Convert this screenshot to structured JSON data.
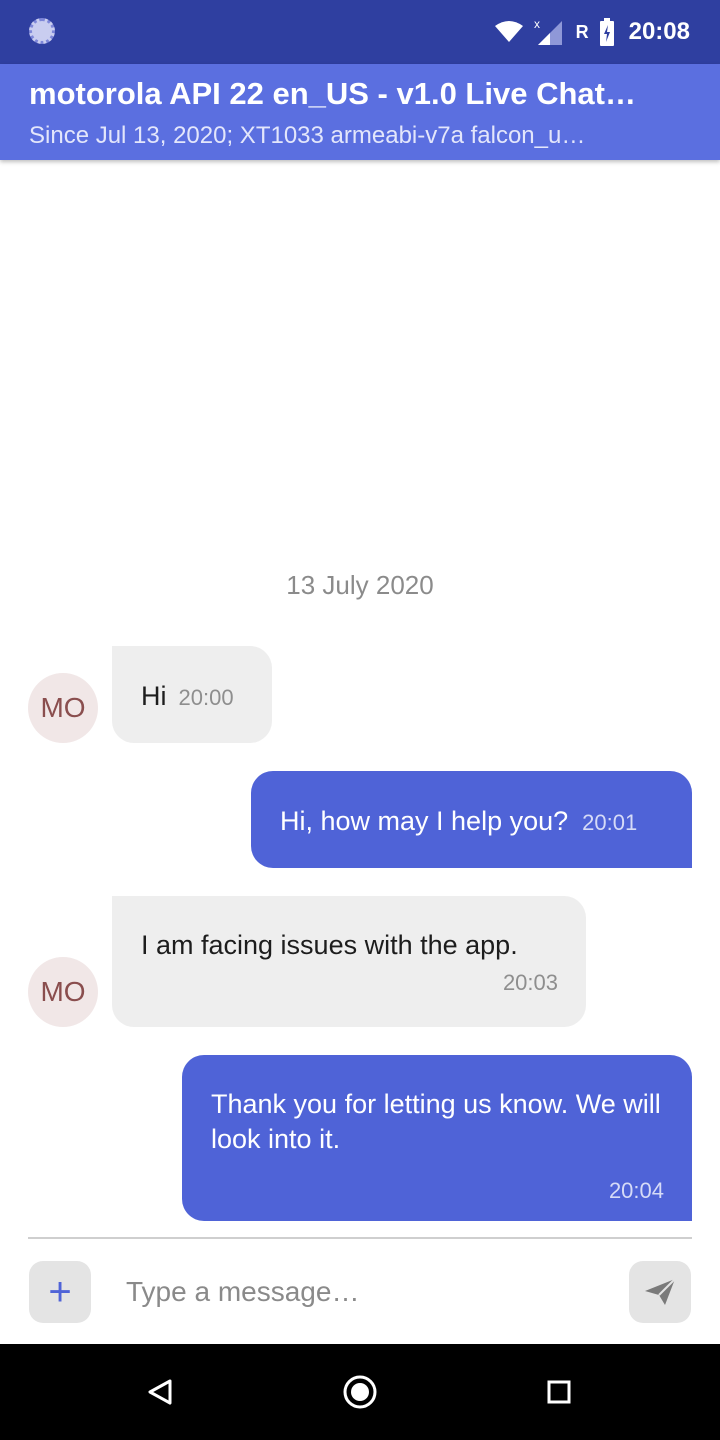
{
  "status_bar": {
    "time": "20:08",
    "roaming_label": "R",
    "icons": [
      "sync-icon",
      "wifi-icon",
      "signal-icon",
      "battery-icon"
    ]
  },
  "app_bar": {
    "title": "motorola API 22 en_US - v1.0 Live Chat…",
    "subtitle": "Since Jul 13, 2020; XT1033 armeabi-v7a falcon_u…"
  },
  "chat": {
    "date_separator": "13 July 2020",
    "avatar_initials": "MO",
    "messages": [
      {
        "direction": "incoming",
        "text": "Hi",
        "time": "20:00"
      },
      {
        "direction": "outgoing",
        "text": "Hi, how may I help you?",
        "time": "20:01"
      },
      {
        "direction": "incoming",
        "text": "I am facing issues with the app.",
        "time": "20:03"
      },
      {
        "direction": "outgoing",
        "text": "Thank you for letting us know. We will look into it.",
        "time": "20:04"
      }
    ]
  },
  "composer": {
    "add_label": "+",
    "placeholder": "Type a message…"
  },
  "colors": {
    "status_bar": "#2f3fa0",
    "app_bar": "#5b6fe0",
    "outgoing_bubble": "#4f63d7",
    "incoming_bubble": "#eeeeee",
    "avatar_bg": "#f1e7e7",
    "avatar_text": "#8a4e4e"
  }
}
